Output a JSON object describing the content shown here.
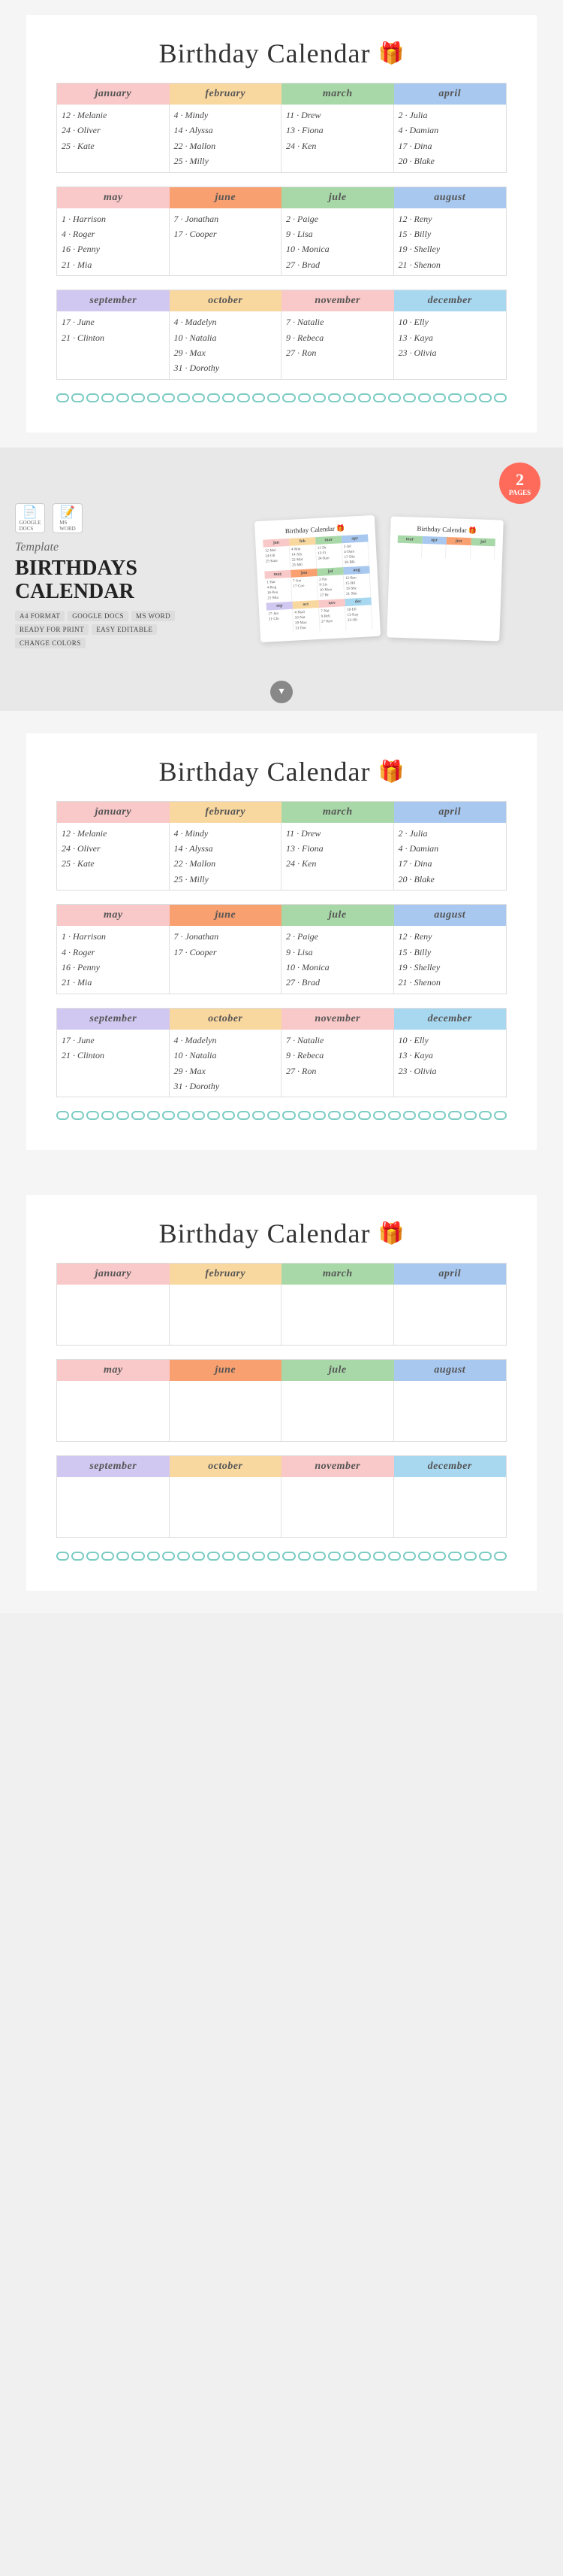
{
  "app": {
    "title": "Birthday Calendar"
  },
  "calendar1": {
    "title": "Birthday Calendar",
    "sections": [
      {
        "months": [
          "january",
          "february",
          "march",
          "april"
        ],
        "colorClasses": [
          "jan",
          "feb",
          "mar",
          "apr"
        ],
        "entries": [
          [
            "12 · Melanie",
            "24 · Oliver",
            "25 · Kate"
          ],
          [
            "4 · Mindy",
            "14 · Alyssa",
            "22 · Mallon",
            "25 · Milly"
          ],
          [
            "11 · Drew",
            "13 · Fiona",
            "24 · Ken"
          ],
          [
            "2 · Julia",
            "4 · Damian",
            "17 · Dina",
            "20 · Blake"
          ]
        ]
      },
      {
        "months": [
          "may",
          "june",
          "jule",
          "august"
        ],
        "colorClasses": [
          "may",
          "jun",
          "jul",
          "aug"
        ],
        "entries": [
          [
            "1 · Harrison",
            "4 · Roger",
            "16 · Penny",
            "21 · Mia"
          ],
          [
            "7 · Jonathan",
            "17 · Cooper"
          ],
          [
            "2 · Paige",
            "9 · Lisa",
            "10 · Monica",
            "27 · Brad"
          ],
          [
            "12 · Reny",
            "15 · Billy",
            "19 · Shelley",
            "21 · Shenon"
          ]
        ]
      },
      {
        "months": [
          "september",
          "october",
          "november",
          "december"
        ],
        "colorClasses": [
          "sep",
          "oct",
          "nov",
          "dec"
        ],
        "entries": [
          [
            "17 · June",
            "21 · Clinton"
          ],
          [
            "4 · Madelyn",
            "10 · Natalia",
            "29 · Max",
            "31 · Dorothy"
          ],
          [
            "7 · Natalie",
            "9 · Rebeca",
            "27 · Ron"
          ],
          [
            "10 · Elly",
            "13 · Kaya",
            "23 · Olivia"
          ]
        ]
      }
    ]
  },
  "promo": {
    "label": "Template",
    "title": "BIRTHDAYS CALENDAR",
    "badges": [
      "A4 FORMAT",
      "GOOGLE DOCS",
      "MS WORD",
      "READY FOR PRINT",
      "EASY EDITABLE",
      "CHANGE COLORS"
    ],
    "pages": "2",
    "pages_label": "PAGES",
    "formats": [
      "GOOGLE DOCS",
      "MS WORD"
    ],
    "scroll_icon": "▾"
  },
  "calendar2": {
    "title": "Birthday Calendar"
  },
  "calendar3": {
    "title": "Birthday Calendar"
  }
}
